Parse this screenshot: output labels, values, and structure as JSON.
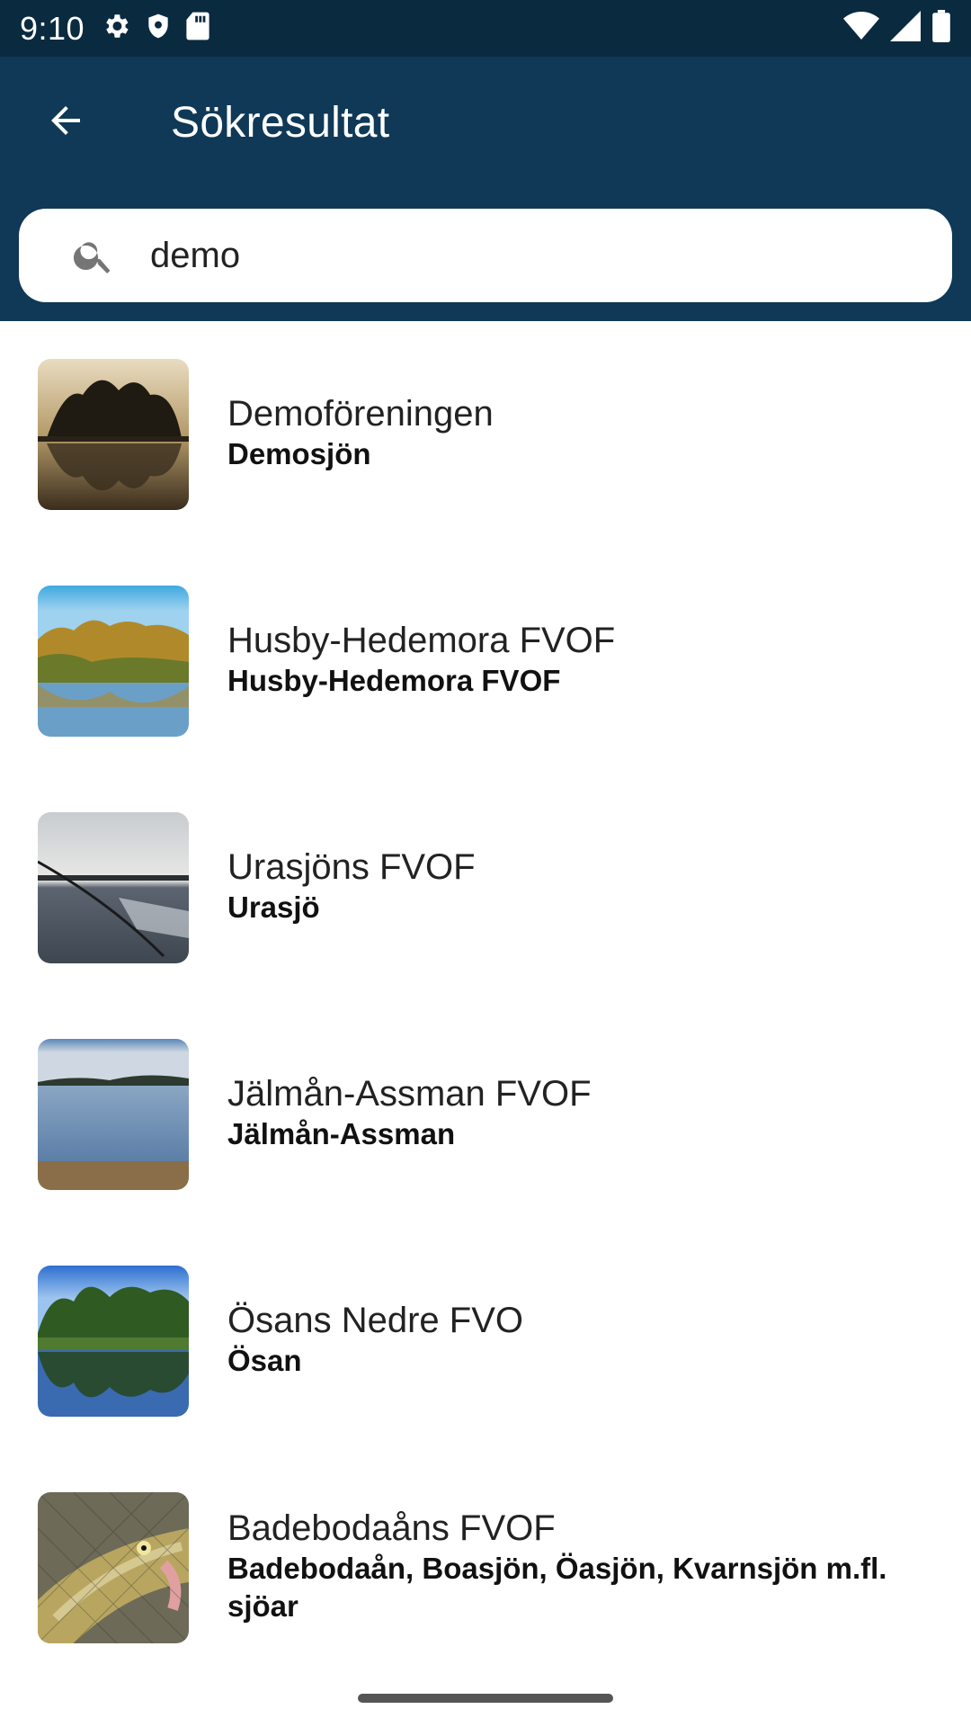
{
  "status_bar": {
    "time": "9:10",
    "left_icons": [
      "gear-icon",
      "shield-icon",
      "sd-card-icon"
    ],
    "right_icons": [
      "wifi-icon",
      "signal-icon",
      "battery-icon"
    ]
  },
  "app_bar": {
    "title": "Sökresultat",
    "back_icon": "arrow-back-icon"
  },
  "search": {
    "value": "demo",
    "icon": "search-icon"
  },
  "colors": {
    "status_bar": "#0a2a40",
    "primary": "#0f3956"
  },
  "results": [
    {
      "title": "Demoföreningen",
      "subtitle": "Demosjön",
      "image": "lake-trees-silhouette"
    },
    {
      "title": "Husby-Hedemora FVOF",
      "subtitle": "Husby-Hedemora FVOF",
      "image": "autumn-forest-lake"
    },
    {
      "title": "Urasjöns FVOF",
      "subtitle": "Urasjö",
      "image": "fishing-rod-lake"
    },
    {
      "title": "Jälmån-Assman FVOF",
      "subtitle": "Jälmån-Assman",
      "image": "calm-lake-shore"
    },
    {
      "title": "Ösans Nedre FVO",
      "subtitle": "Ösan",
      "image": "river-trees-reflection"
    },
    {
      "title": "Badebodaåns FVOF",
      "subtitle": "Badebodaån, Boasjön, Öasjön, Kvarnsjön m.fl. sjöar",
      "image": "pike-in-net"
    }
  ]
}
